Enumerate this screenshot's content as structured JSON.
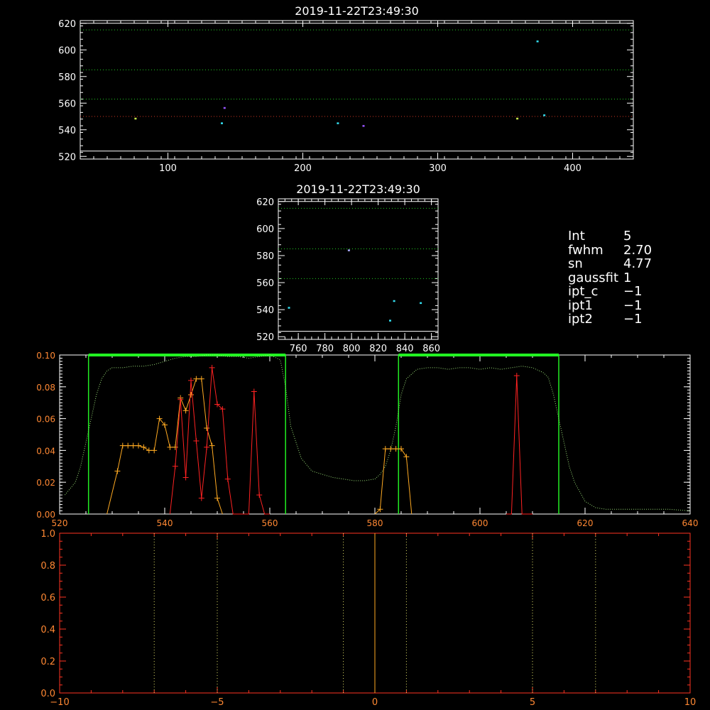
{
  "chart_data": [
    {
      "id": "top-scatter",
      "type": "scatter",
      "title": "2019-11-22T23:49:30",
      "xlim": [
        35,
        445
      ],
      "ylim": [
        518,
        622
      ],
      "xticks": [
        100,
        200,
        300,
        400
      ],
      "yticks": [
        520,
        540,
        560,
        580,
        600,
        620
      ],
      "hlines": [
        {
          "y": 620,
          "color": "#ffffff",
          "style": "solid"
        },
        {
          "y": 615,
          "color": "#22cc22",
          "style": "dotted"
        },
        {
          "y": 585,
          "color": "#22cc22",
          "style": "dotted"
        },
        {
          "y": 563,
          "color": "#22cc22",
          "style": "dotted"
        },
        {
          "y": 550,
          "color": "#cc3322",
          "style": "dotted"
        },
        {
          "y": 524,
          "color": "#ffffff",
          "style": "solid"
        }
      ],
      "points": [
        {
          "x": 76,
          "y": 548.5,
          "color": "#c8e84a"
        },
        {
          "x": 140,
          "y": 545,
          "color": "#33ddee"
        },
        {
          "x": 142,
          "y": 556.5,
          "color": "#9955ff"
        },
        {
          "x": 226,
          "y": 545,
          "color": "#33ddee"
        },
        {
          "x": 245,
          "y": 543,
          "color": "#9955ff"
        },
        {
          "x": 359,
          "y": 548.5,
          "color": "#c8e84a"
        },
        {
          "x": 374,
          "y": 606.5,
          "color": "#33ddee"
        },
        {
          "x": 379,
          "y": 551,
          "color": "#33ddee"
        }
      ]
    },
    {
      "id": "middle-scatter",
      "type": "scatter",
      "title": "2019-11-22T23:49:30",
      "xlim": [
        745,
        865
      ],
      "ylim": [
        518,
        622
      ],
      "xticks": [
        760,
        780,
        800,
        820,
        840,
        860
      ],
      "yticks": [
        520,
        540,
        560,
        580,
        600,
        620
      ],
      "hlines": [
        {
          "y": 620,
          "color": "#ffffff",
          "style": "solid"
        },
        {
          "y": 615,
          "color": "#22cc22",
          "style": "dotted"
        },
        {
          "y": 585,
          "color": "#22cc22",
          "style": "dotted"
        },
        {
          "y": 563,
          "color": "#22cc22",
          "style": "dotted"
        },
        {
          "y": 524,
          "color": "#ffffff",
          "style": "solid"
        }
      ],
      "points": [
        {
          "x": 753,
          "y": 541.5,
          "color": "#33ddee"
        },
        {
          "x": 798,
          "y": 584,
          "color": "#aaaaff"
        },
        {
          "x": 829,
          "y": 532,
          "color": "#33ddee"
        },
        {
          "x": 832,
          "y": 546.5,
          "color": "#33ddee"
        },
        {
          "x": 852,
          "y": 545,
          "color": "#33ddee"
        }
      ]
    },
    {
      "id": "spectrum",
      "type": "line",
      "xlim": [
        520,
        640
      ],
      "ylim": [
        0,
        1.0
      ],
      "xticks": [
        520,
        540,
        560,
        580,
        600,
        620,
        640
      ],
      "yticks": [
        0.0,
        0.2,
        0.4,
        0.6,
        0.8,
        1.0
      ],
      "ytick_labels": [
        "0.00",
        "0.02",
        "0.04",
        "0.06",
        "0.08",
        "0.10"
      ],
      "bands": [
        [
          525.5,
          563
        ],
        [
          584.5,
          615
        ]
      ],
      "series": [
        {
          "style": "dotted",
          "color": "#99dd77",
          "x": [
            521,
            523,
            524,
            525,
            526,
            527,
            528,
            529,
            530,
            532,
            534,
            536,
            538,
            540,
            542,
            544,
            546,
            548,
            550,
            552,
            554,
            556,
            558,
            560,
            562,
            563,
            564,
            566,
            568,
            570,
            572,
            574,
            576,
            578,
            580,
            581,
            582,
            583,
            584,
            585,
            586,
            588,
            590,
            592,
            594,
            596,
            598,
            600,
            602,
            604,
            606,
            608,
            610,
            612,
            613,
            614,
            615,
            616,
            617,
            618,
            620,
            622,
            624,
            628,
            632,
            636,
            640
          ],
          "y": [
            0.12,
            0.2,
            0.3,
            0.45,
            0.6,
            0.75,
            0.85,
            0.9,
            0.92,
            0.92,
            0.93,
            0.93,
            0.94,
            0.96,
            0.98,
            0.99,
            0.99,
            1.0,
            1.0,
            0.99,
            0.99,
            0.98,
            0.99,
            1.0,
            0.97,
            0.8,
            0.55,
            0.35,
            0.27,
            0.25,
            0.23,
            0.22,
            0.21,
            0.21,
            0.22,
            0.25,
            0.3,
            0.4,
            0.55,
            0.75,
            0.85,
            0.91,
            0.92,
            0.92,
            0.91,
            0.92,
            0.92,
            0.91,
            0.92,
            0.91,
            0.92,
            0.93,
            0.92,
            0.89,
            0.86,
            0.75,
            0.6,
            0.45,
            0.3,
            0.2,
            0.08,
            0.04,
            0.03,
            0.03,
            0.03,
            0.03,
            0.02
          ]
        },
        {
          "style": "plus",
          "color": "#ffaa22",
          "x": [
            529,
            531,
            532,
            533,
            534,
            535,
            536,
            537,
            538,
            539,
            540,
            541,
            542,
            543,
            544,
            545,
            546,
            547,
            548,
            549,
            550,
            551
          ],
          "y": [
            0,
            0.27,
            0.43,
            0.43,
            0.43,
            0.43,
            0.42,
            0.4,
            0.4,
            0.6,
            0.56,
            0.42,
            0.42,
            0.73,
            0.65,
            0.75,
            0.85,
            0.85,
            0.54,
            0.43,
            0.1,
            0
          ],
          "x2": [
            580,
            581,
            582,
            583,
            584,
            585,
            586,
            587
          ],
          "y2": [
            0,
            0.03,
            0.41,
            0.41,
            0.41,
            0.41,
            0.36,
            0
          ]
        },
        {
          "style": "plus",
          "color": "#ff2222",
          "x": [
            541,
            542,
            543,
            544,
            545,
            546,
            547,
            548,
            549,
            550,
            551,
            552,
            553,
            554,
            555,
            556,
            557,
            558,
            559,
            560
          ],
          "y": [
            0,
            0.3,
            0.72,
            0.23,
            0.84,
            0.46,
            0.1,
            0.42,
            0.92,
            0.69,
            0.66,
            0.22,
            0,
            0,
            0,
            0,
            0.77,
            0.12,
            0,
            0
          ],
          "x2": [
            605,
            606,
            607,
            608,
            609,
            610
          ],
          "y2": [
            0,
            0,
            0.87,
            0,
            0,
            0
          ]
        }
      ]
    },
    {
      "id": "velocity",
      "type": "line",
      "xlim": [
        -10,
        10
      ],
      "ylim": [
        0,
        1.0
      ],
      "xticks": [
        -10,
        -5,
        0,
        5,
        10
      ],
      "yticks": [
        0.0,
        0.2,
        0.4,
        0.6,
        0.8,
        1.0
      ],
      "ytick_labels": [
        "0.0",
        "0.2",
        "0.4",
        "0.6",
        "0.8",
        "1.0"
      ],
      "vlines": [
        {
          "x": -7,
          "color": "#dddd66",
          "style": "dotted"
        },
        {
          "x": -5,
          "color": "#dddd66",
          "style": "dotted"
        },
        {
          "x": -1,
          "color": "#dddd66",
          "style": "dotted"
        },
        {
          "x": 0,
          "color": "#ffaa22",
          "style": "solid"
        },
        {
          "x": 1,
          "color": "#dddd66",
          "style": "dotted"
        },
        {
          "x": 5,
          "color": "#dddd66",
          "style": "dotted"
        },
        {
          "x": 7,
          "color": "#dddd66",
          "style": "dotted"
        }
      ]
    }
  ],
  "info": [
    {
      "key": "Int",
      "value": "5"
    },
    {
      "key": "fwhm",
      "value": "2.70"
    },
    {
      "key": "sn",
      "value": "4.77"
    },
    {
      "key": "gaussfit",
      "value": "1"
    },
    {
      "key": "ipt_c",
      "value": "−1"
    },
    {
      "key": "ipt1",
      "value": "−1"
    },
    {
      "key": "ipt2",
      "value": "−1"
    }
  ]
}
